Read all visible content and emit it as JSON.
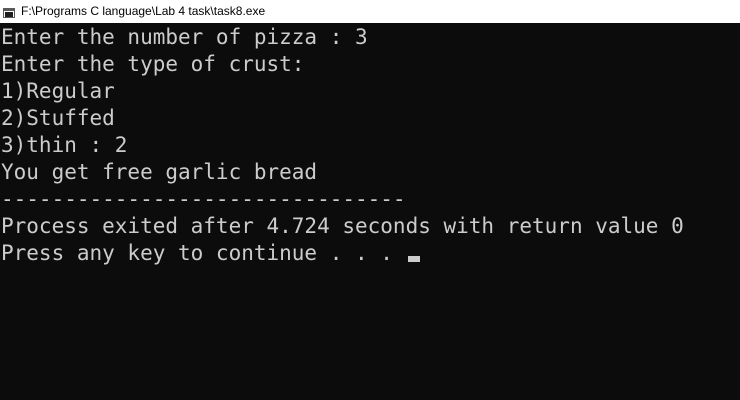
{
  "window": {
    "title": "F:\\Programs C language\\Lab 4 task\\task8.exe",
    "icon": "console-app-icon"
  },
  "console": {
    "lines": [
      "Enter the number of pizza : 3",
      "Enter the type of crust:",
      "1)Regular",
      "2)Stuffed",
      "3)thin : 2",
      "You get free garlic bread",
      "--------------------------------",
      "Process exited after 4.724 seconds with return value 0",
      "Press any key to continue . . . "
    ]
  },
  "colors": {
    "background": "#0c0c0c",
    "text": "#cccccc",
    "titlebar": "#ffffff"
  }
}
